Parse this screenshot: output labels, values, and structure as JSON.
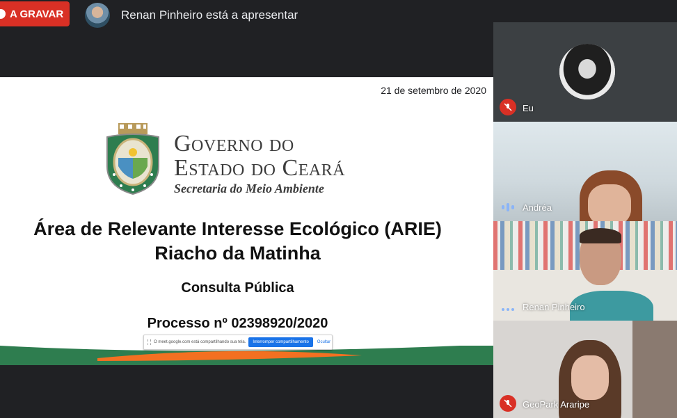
{
  "topbar": {
    "recording_label": "A GRAVAR",
    "presenter_text": "Renan Pinheiro está a apresentar"
  },
  "slide": {
    "date": "21 de setembro de 2020",
    "logo_line1": "Governo do",
    "logo_line2": "Estado do Ceará",
    "logo_sub": "Secretaria do Meio Ambiente",
    "title_line1": "Área de Relevante Interesse Ecológico (ARIE)",
    "title_line2": "Riacho da Matinha",
    "subtitle": "Consulta Pública",
    "process": "Processo nº 02398920/2020",
    "share_bar": {
      "message": "O meet.google.com está compartilhando sua tela.",
      "stop_label": "Interromper compartilhamento",
      "hide_label": "Ocultar"
    }
  },
  "participants": [
    {
      "name": "Eu",
      "mic": "muted"
    },
    {
      "name": "Andréa",
      "mic": "speaking"
    },
    {
      "name": "Renan Pinheiro",
      "mic": "active"
    },
    {
      "name": "GeoPark Araripe",
      "mic": "muted"
    }
  ],
  "colors": {
    "record_red": "#d93025",
    "slide_green": "#2e7d4f",
    "slide_orange": "#f37021",
    "accent_blue": "#1a73e8"
  }
}
